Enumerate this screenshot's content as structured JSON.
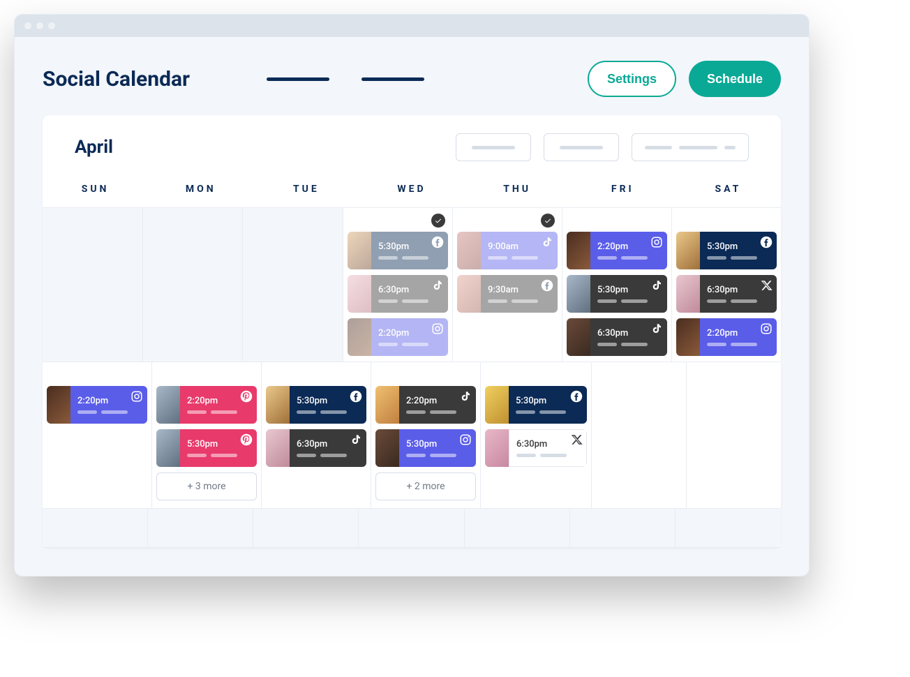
{
  "header": {
    "title": "Social Calendar",
    "settings_label": "Settings",
    "schedule_label": "Schedule"
  },
  "calendar": {
    "month": "April",
    "days_of_week": [
      "SUN",
      "MON",
      "TUE",
      "WED",
      "THU",
      "FRI",
      "SAT"
    ]
  },
  "weeks": [
    {
      "cells": [
        {
          "empty": true
        },
        {
          "empty": true
        },
        {
          "empty": true
        },
        {
          "checked": true,
          "muted": true,
          "events": [
            {
              "time": "5:30pm",
              "platform": "facebook",
              "color": "navy",
              "thumb": "th-a"
            },
            {
              "time": "6:30pm",
              "platform": "tiktok",
              "color": "dark",
              "thumb": "th-c"
            },
            {
              "time": "2:20pm",
              "platform": "instagram",
              "color": "indigo",
              "thumb": "th-d"
            }
          ]
        },
        {
          "checked": true,
          "muted": true,
          "events": [
            {
              "time": "9:00am",
              "platform": "tiktok",
              "color": "indigo",
              "thumb": "th-b"
            },
            {
              "time": "9:30am",
              "platform": "facebook",
              "color": "dark",
              "thumb": "th-h"
            }
          ]
        },
        {
          "events": [
            {
              "time": "2:20pm",
              "platform": "instagram",
              "color": "indigo",
              "thumb": "th-d"
            },
            {
              "time": "5:30pm",
              "platform": "tiktok",
              "color": "dark",
              "thumb": "th-i"
            },
            {
              "time": "6:30pm",
              "platform": "tiktok",
              "color": "dark",
              "thumb": "th-k"
            }
          ]
        },
        {
          "events": [
            {
              "time": "5:30pm",
              "platform": "facebook",
              "color": "navy",
              "thumb": "th-e"
            },
            {
              "time": "6:30pm",
              "platform": "x",
              "color": "dark",
              "thumb": "th-f"
            },
            {
              "time": "2:20pm",
              "platform": "instagram",
              "color": "indigo",
              "thumb": "th-d"
            }
          ]
        }
      ]
    },
    {
      "cells": [
        {
          "events": [
            {
              "time": "2:20pm",
              "platform": "instagram",
              "color": "indigo",
              "thumb": "th-d"
            }
          ]
        },
        {
          "events": [
            {
              "time": "2:20pm",
              "platform": "pinterest",
              "color": "pink",
              "thumb": "th-i"
            },
            {
              "time": "5:30pm",
              "platform": "pinterest",
              "color": "pink",
              "thumb": "th-i"
            }
          ],
          "more": "+ 3 more"
        },
        {
          "events": [
            {
              "time": "5:30pm",
              "platform": "facebook",
              "color": "navy",
              "thumb": "th-e"
            },
            {
              "time": "6:30pm",
              "platform": "tiktok",
              "color": "dark",
              "thumb": "th-f"
            }
          ]
        },
        {
          "events": [
            {
              "time": "2:20pm",
              "platform": "tiktok",
              "color": "dark",
              "thumb": "th-j"
            },
            {
              "time": "5:30pm",
              "platform": "instagram",
              "color": "indigo",
              "thumb": "th-k"
            }
          ],
          "more": "+ 2 more"
        },
        {
          "events": [
            {
              "time": "5:30pm",
              "platform": "facebook",
              "color": "navy",
              "thumb": "th-g"
            },
            {
              "time": "6:30pm",
              "platform": "x",
              "color": "white",
              "thumb": "th-l"
            }
          ]
        },
        {
          "empty": false
        },
        {
          "empty": false
        }
      ]
    },
    {
      "cells": [
        {
          "empty": true
        },
        {
          "empty": true
        },
        {
          "empty": true
        },
        {
          "empty": true
        },
        {
          "empty": true
        },
        {
          "empty": true
        },
        {
          "empty": true
        }
      ]
    }
  ]
}
